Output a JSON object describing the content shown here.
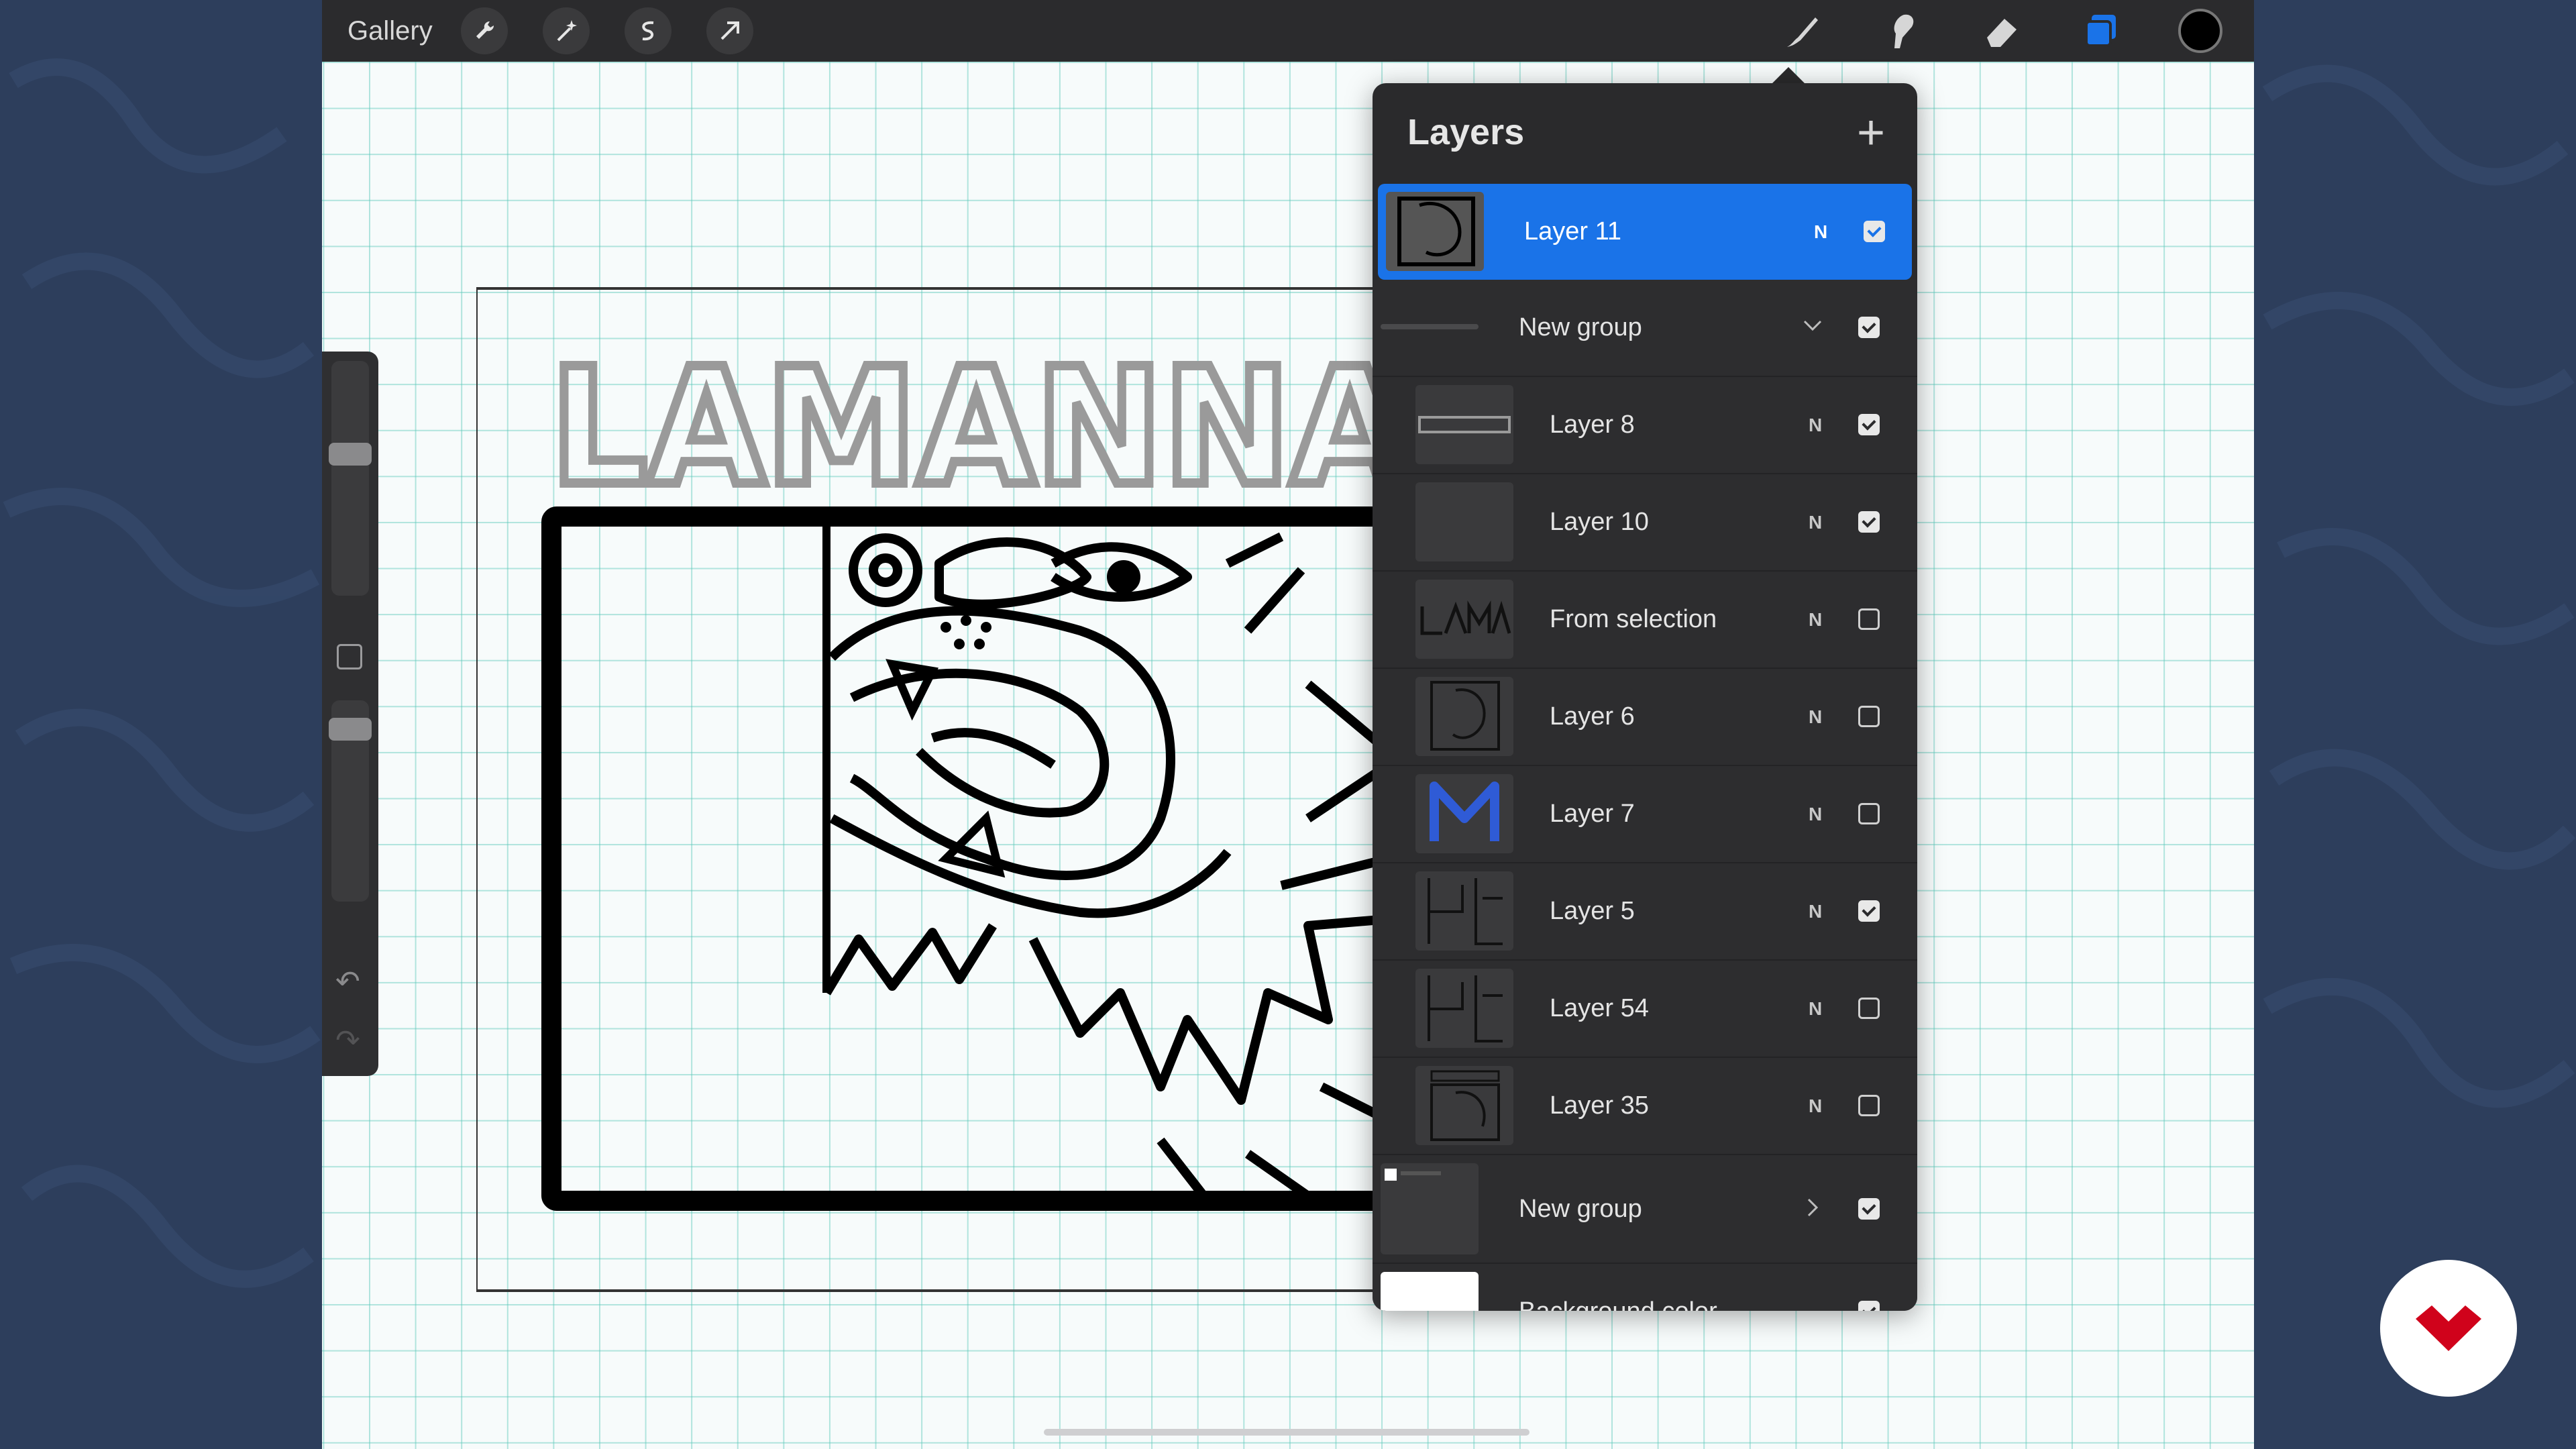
{
  "topbar": {
    "gallery_label": "Gallery",
    "left_tools": [
      "wrench-icon",
      "magic-wand-icon",
      "selection-icon",
      "transform-arrow-icon"
    ],
    "right_tools": [
      "brush-icon",
      "smudge-icon",
      "eraser-icon",
      "layers-icon"
    ],
    "active_color": "#000000"
  },
  "layers_panel": {
    "title": "Layers",
    "add_label": "+",
    "rows": [
      {
        "name": "Layer 11",
        "blend": "N",
        "visible": true
      },
      {
        "name": "New group",
        "visible": true
      },
      {
        "name": "Layer 8",
        "blend": "N",
        "visible": true
      },
      {
        "name": "Layer 10",
        "blend": "N",
        "visible": true
      },
      {
        "name": "From selection",
        "blend": "N",
        "visible": false
      },
      {
        "name": "Layer 6",
        "blend": "N",
        "visible": false
      },
      {
        "name": "Layer 7",
        "blend": "N",
        "visible": false
      },
      {
        "name": "Layer 5",
        "blend": "N",
        "visible": true
      },
      {
        "name": "Layer 54",
        "blend": "N",
        "visible": false
      },
      {
        "name": "Layer 35",
        "blend": "N",
        "visible": false
      },
      {
        "name": "New group",
        "visible": true
      },
      {
        "name": "Background color",
        "visible": true
      }
    ]
  },
  "artwork": {
    "title_text": "LAMANNA"
  },
  "colors": {
    "selected_layer": "#1a73e8",
    "panel_bg": "#2a2a2c",
    "brand_red": "#d0021b"
  }
}
